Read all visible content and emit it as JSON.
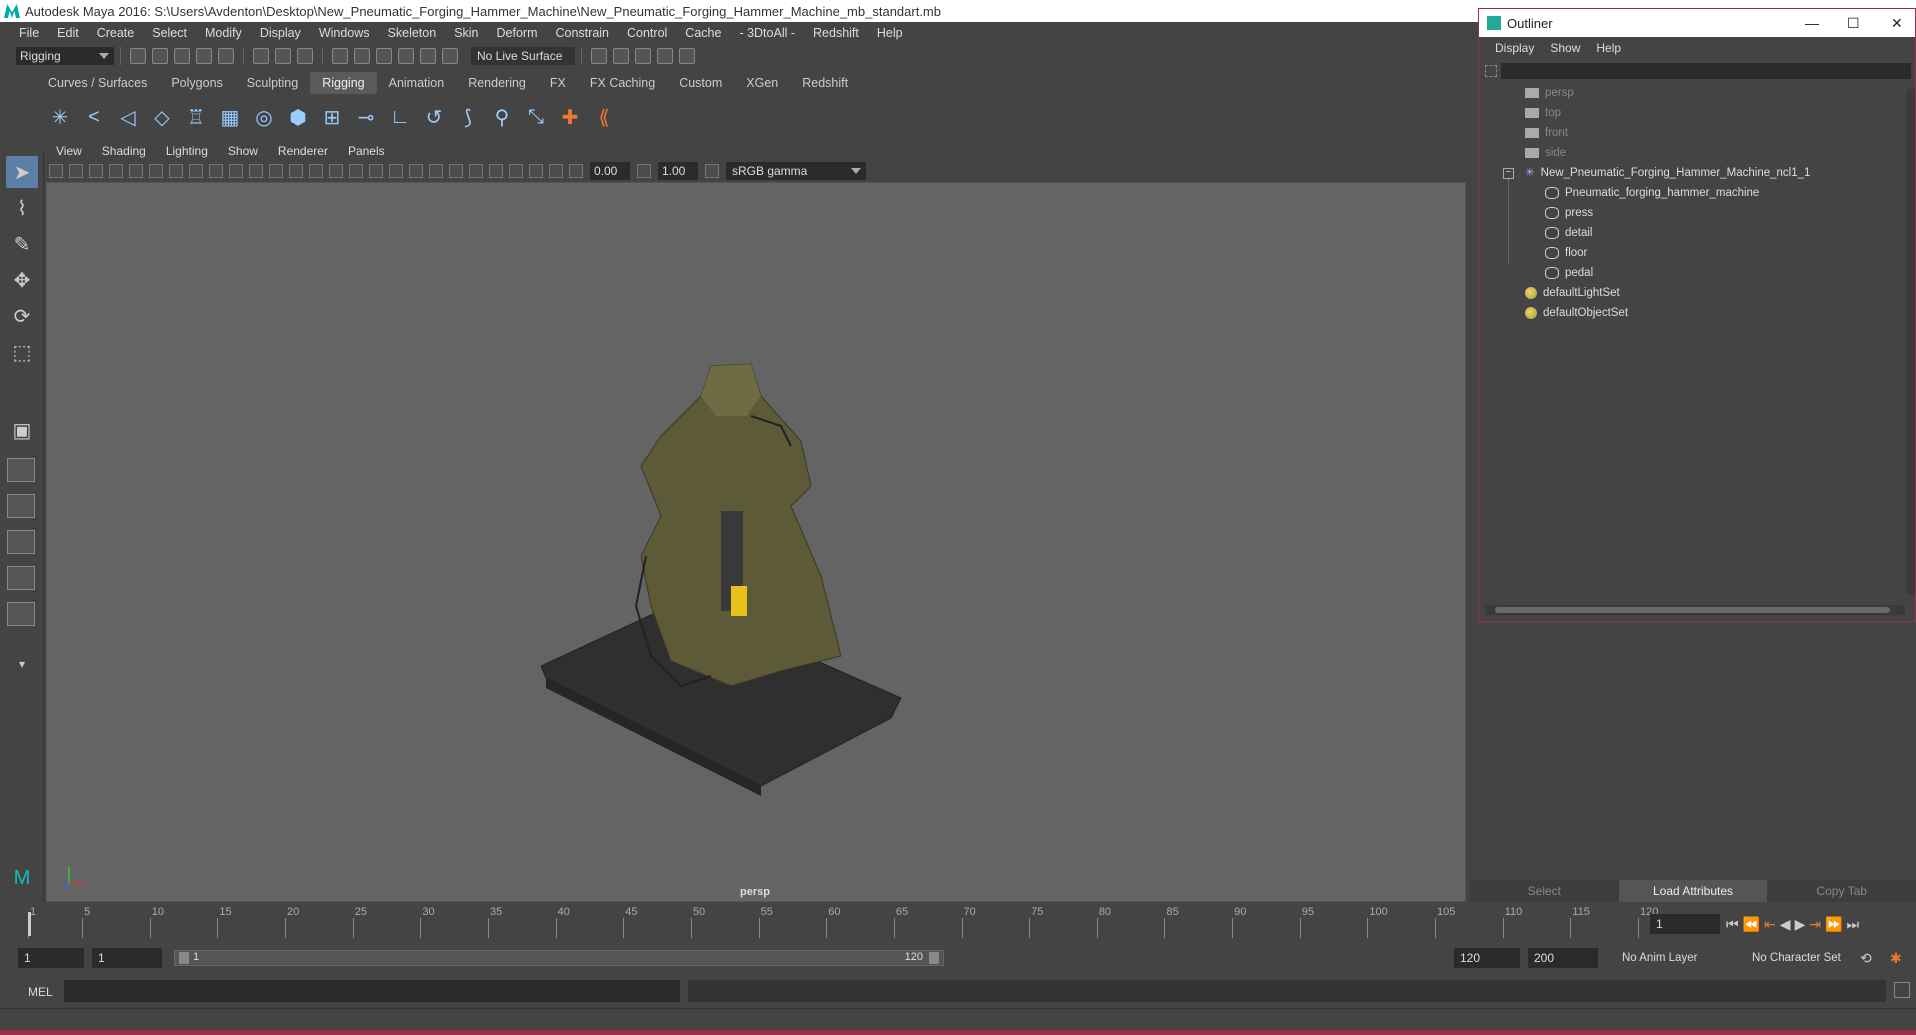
{
  "window_title": "Autodesk Maya 2016: S:\\Users\\Avdenton\\Desktop\\New_Pneumatic_Forging_Hammer_Machine\\New_Pneumatic_Forging_Hammer_Machine_mb_standart.mb",
  "menubar": [
    "File",
    "Edit",
    "Create",
    "Select",
    "Modify",
    "Display",
    "Windows",
    "Skeleton",
    "Skin",
    "Deform",
    "Constrain",
    "Control",
    "Cache",
    "- 3DtoAll -",
    "Redshift",
    "Help"
  ],
  "status_line": {
    "mode": "Rigging",
    "live_surface": "No Live Surface"
  },
  "shelf_tabs": [
    "Curves / Surfaces",
    "Polygons",
    "Sculpting",
    "Rigging",
    "Animation",
    "Rendering",
    "FX",
    "FX Caching",
    "Custom",
    "XGen",
    "Redshift"
  ],
  "active_shelf_tab": "Rigging",
  "viewport_menu": [
    "View",
    "Shading",
    "Lighting",
    "Show",
    "Renderer",
    "Panels"
  ],
  "viewport_toolbar": {
    "exposure": "0.00",
    "gamma": "1.00",
    "color_space": "sRGB gamma"
  },
  "viewport_label": "persp",
  "outliner": {
    "title": "Outliner",
    "menu": [
      "Display",
      "Show",
      "Help"
    ],
    "cameras": [
      "persp",
      "top",
      "front",
      "side"
    ],
    "group": "New_Pneumatic_Forging_Hammer_Machine_ncl1_1",
    "children": [
      "Pneumatic_forging_hammer_machine",
      "press",
      "detail",
      "floor",
      "pedal"
    ],
    "sets": [
      "defaultLightSet",
      "defaultObjectSet"
    ]
  },
  "attribute_tabs": [
    "Select",
    "Load Attributes",
    "Copy Tab"
  ],
  "time_slider": {
    "ticks": [
      "1",
      "5",
      "10",
      "15",
      "20",
      "25",
      "30",
      "35",
      "40",
      "45",
      "50",
      "55",
      "60",
      "65",
      "70",
      "75",
      "80",
      "85",
      "90",
      "95",
      "100",
      "105",
      "110",
      "115",
      "120"
    ],
    "current_frame": "1"
  },
  "range": {
    "start": "1",
    "playback_start": "1",
    "slider_start": "1",
    "slider_end": "120",
    "playback_end": "120",
    "end": "200",
    "anim_layer": "No Anim Layer",
    "character_set": "No Character Set"
  },
  "command_line": {
    "label": "MEL"
  }
}
